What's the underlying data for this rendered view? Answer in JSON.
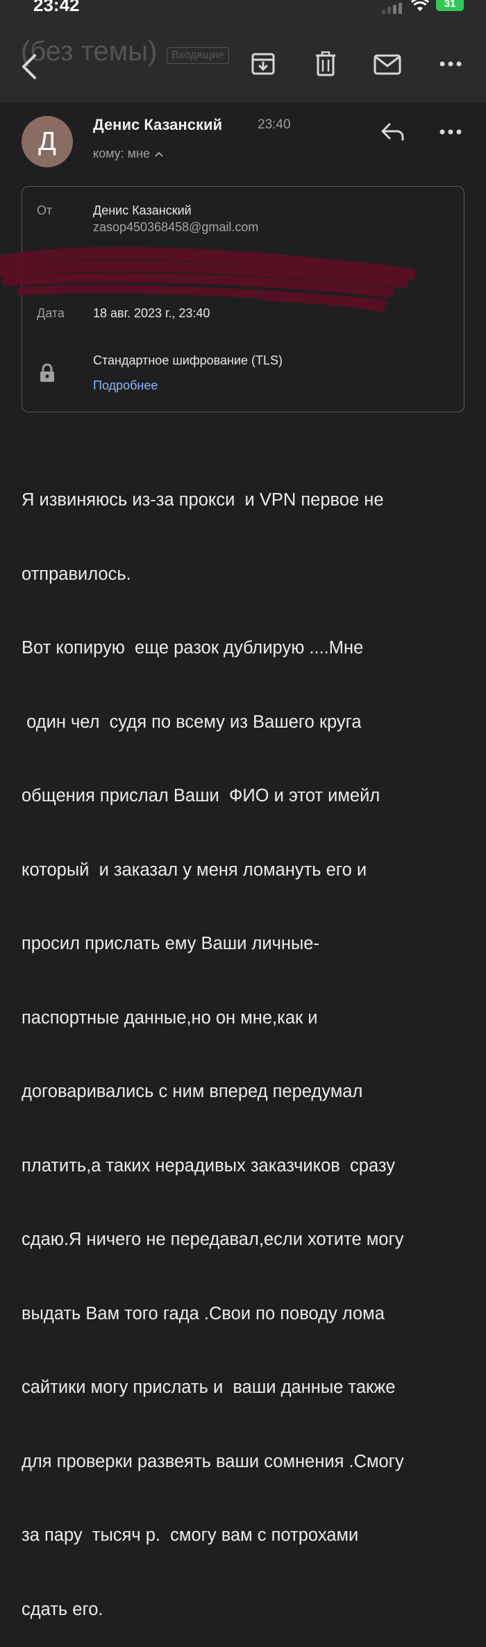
{
  "status": {
    "time": "23:42",
    "battery": "31"
  },
  "header": {
    "subject": "(без темы)",
    "folder_badge": "Входящие"
  },
  "sender": {
    "initial": "Д",
    "name": "Денис Казанский",
    "time": "23:40",
    "to_line": "кому: мне"
  },
  "details": {
    "from_label": "От",
    "from_name": "Денис Казанский",
    "from_email": "zasop450368458@gmail.com",
    "date_label": "Дата",
    "date_value": "18 авг. 2023 г., 23:40",
    "encryption": "Стандартное шифрование (TLS)",
    "more_link": "Подробнее"
  },
  "message": {
    "lines": [
      "Я извиняюсь из-за прокси  и VPN первое не",
      "отправилось.",
      "Вот копирую  еще разок дублирую ....Мне",
      " один чел  судя по всему из Вашего круга",
      "общения прислал Ваши  ФИО и этот имейл",
      "который  и заказал у меня ломануть его и",
      "просил прислать ему Ваши личные-",
      "паспортные данные,но он мне,как и",
      "договаривались с ним вперед передумал",
      "платить,а таких нерадивых заказчиков  сразу",
      "сдаю.Я ничего не передавал,если хотите могу",
      "выдать Вам того гада .Свои по поводу лома",
      "сайтики могу прислать и  ваши данные также",
      "для проверки развеять ваши сомнения .Смогу",
      "за пару  тысяч р.  смогу вам с потрохами",
      "сдать его."
    ]
  },
  "colors": {
    "background": "#1f1f21",
    "toolbar": "#2b2b2d",
    "avatar": "#8a6d62",
    "link": "#8ab4f8",
    "redaction": "#5a0f24",
    "battery": "#33c759"
  }
}
